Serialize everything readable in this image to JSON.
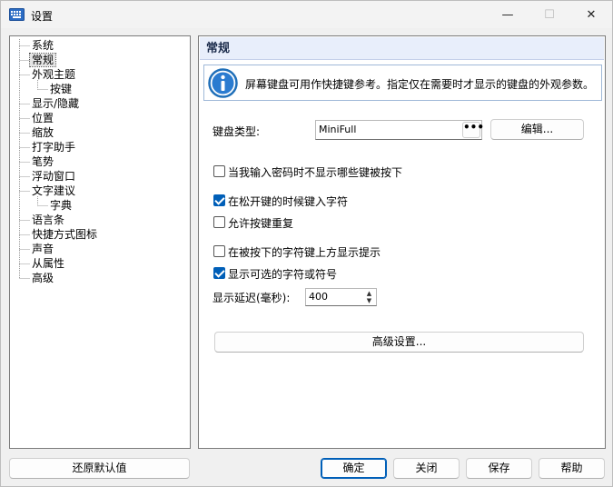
{
  "window": {
    "title": "设置",
    "min_glyph": "—",
    "max_glyph": "☐",
    "close_glyph": "✕"
  },
  "tree": {
    "items": [
      {
        "label": "系统"
      },
      {
        "label": "常规"
      },
      {
        "label": "外观主题"
      },
      {
        "label": "按键"
      },
      {
        "label": "显示/隐藏"
      },
      {
        "label": "位置"
      },
      {
        "label": "缩放"
      },
      {
        "label": "打字助手"
      },
      {
        "label": "笔势"
      },
      {
        "label": "浮动窗口"
      },
      {
        "label": "文字建议"
      },
      {
        "label": "字典"
      },
      {
        "label": "语言条"
      },
      {
        "label": "快捷方式图标"
      },
      {
        "label": "声音"
      },
      {
        "label": "从属性"
      },
      {
        "label": "高级"
      }
    ]
  },
  "panel": {
    "header": "常规",
    "info_text": "屏幕键盘可用作快捷键参考。指定仅在需要时才显示的键盘的外观参数。",
    "keyboard_type_label": "键盘类型:",
    "keyboard_type_value": "MiniFull",
    "combo_button": "•••",
    "edit_button": "编辑...",
    "options": {
      "hide_on_password": {
        "label": "当我输入密码时不显示哪些键被按下",
        "checked": false
      },
      "input_on_release": {
        "label": "在松开键的时候键入字符",
        "checked": true
      },
      "allow_repeat": {
        "label": "允许按键重复",
        "checked": false
      },
      "show_hint_above": {
        "label": "在被按下的字符键上方显示提示",
        "checked": false
      },
      "show_optional_chars": {
        "label": "显示可选的字符或符号",
        "checked": true
      }
    },
    "delay_label": "显示延迟(毫秒):",
    "delay_value": "400",
    "spin_up": "▲",
    "spin_down": "▼",
    "advanced_button": "高级设置..."
  },
  "footer": {
    "restore_defaults": "还原默认值",
    "ok": "确定",
    "close": "关闭",
    "save": "保存",
    "help": "帮助"
  },
  "colors": {
    "accent": "#005fb8",
    "header_bg": "#e8eefb",
    "info_icon": "#1f6fb9"
  }
}
